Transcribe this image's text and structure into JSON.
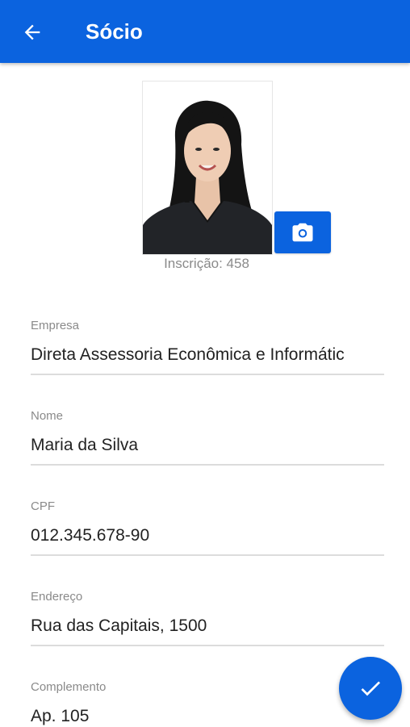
{
  "app_bar": {
    "title": "Sócio",
    "back_icon": "arrow-left-icon",
    "color": "#0b63df"
  },
  "profile": {
    "photo_alt": "Foto do sócio",
    "camera_icon": "camera-icon",
    "inscricao": "Inscrição: 458"
  },
  "fields": [
    {
      "label": "Empresa",
      "value": "Direta Assessoria Econômica e Informátic"
    },
    {
      "label": "Nome",
      "value": "Maria da Silva"
    },
    {
      "label": "CPF",
      "value": "012.345.678-90"
    },
    {
      "label": "Endereço",
      "value": "Rua das Capitais, 1500"
    },
    {
      "label": "Complemento",
      "value": "Ap. 105"
    }
  ],
  "fab": {
    "icon": "check-icon"
  }
}
